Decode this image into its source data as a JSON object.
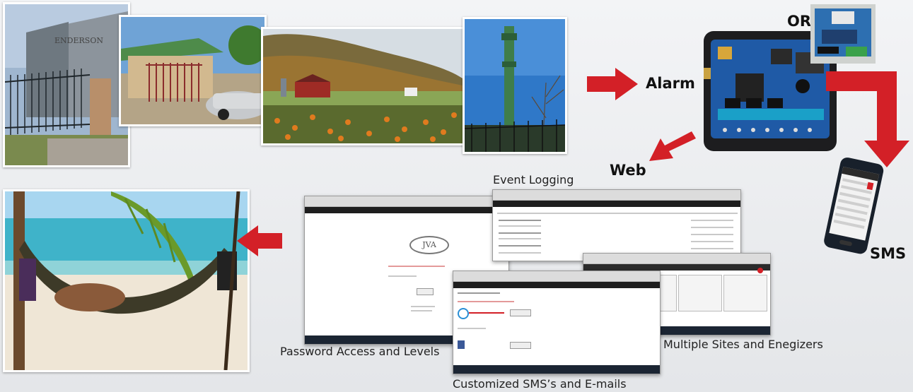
{
  "labels": {
    "or": "OR",
    "alarm": "Alarm",
    "web": "Web",
    "sms": "SMS",
    "event_logging": "Event Logging",
    "password_access": "Password Access and Levels",
    "multiple_sites": "Multiple Sites and Enegizers",
    "customized_sms": "Customized SMS’s and E-mails"
  },
  "photos": [
    {
      "name": "photo-building-fence",
      "subject": "industrial building behind palisade fence"
    },
    {
      "name": "photo-house-gate",
      "subject": "house with electric gate and car"
    },
    {
      "name": "photo-farm",
      "subject": "farm with red barn and pumpkin field"
    },
    {
      "name": "photo-cell-tower",
      "subject": "cell tower behind fence"
    },
    {
      "name": "photo-hammock-beach",
      "subject": "person relaxing in hammock on beach"
    }
  ],
  "screens": {
    "login_logo": "JVA"
  },
  "colors": {
    "arrow_red": "#d32027",
    "board_blue": "#1f5aa6",
    "background": "#eceef0"
  }
}
